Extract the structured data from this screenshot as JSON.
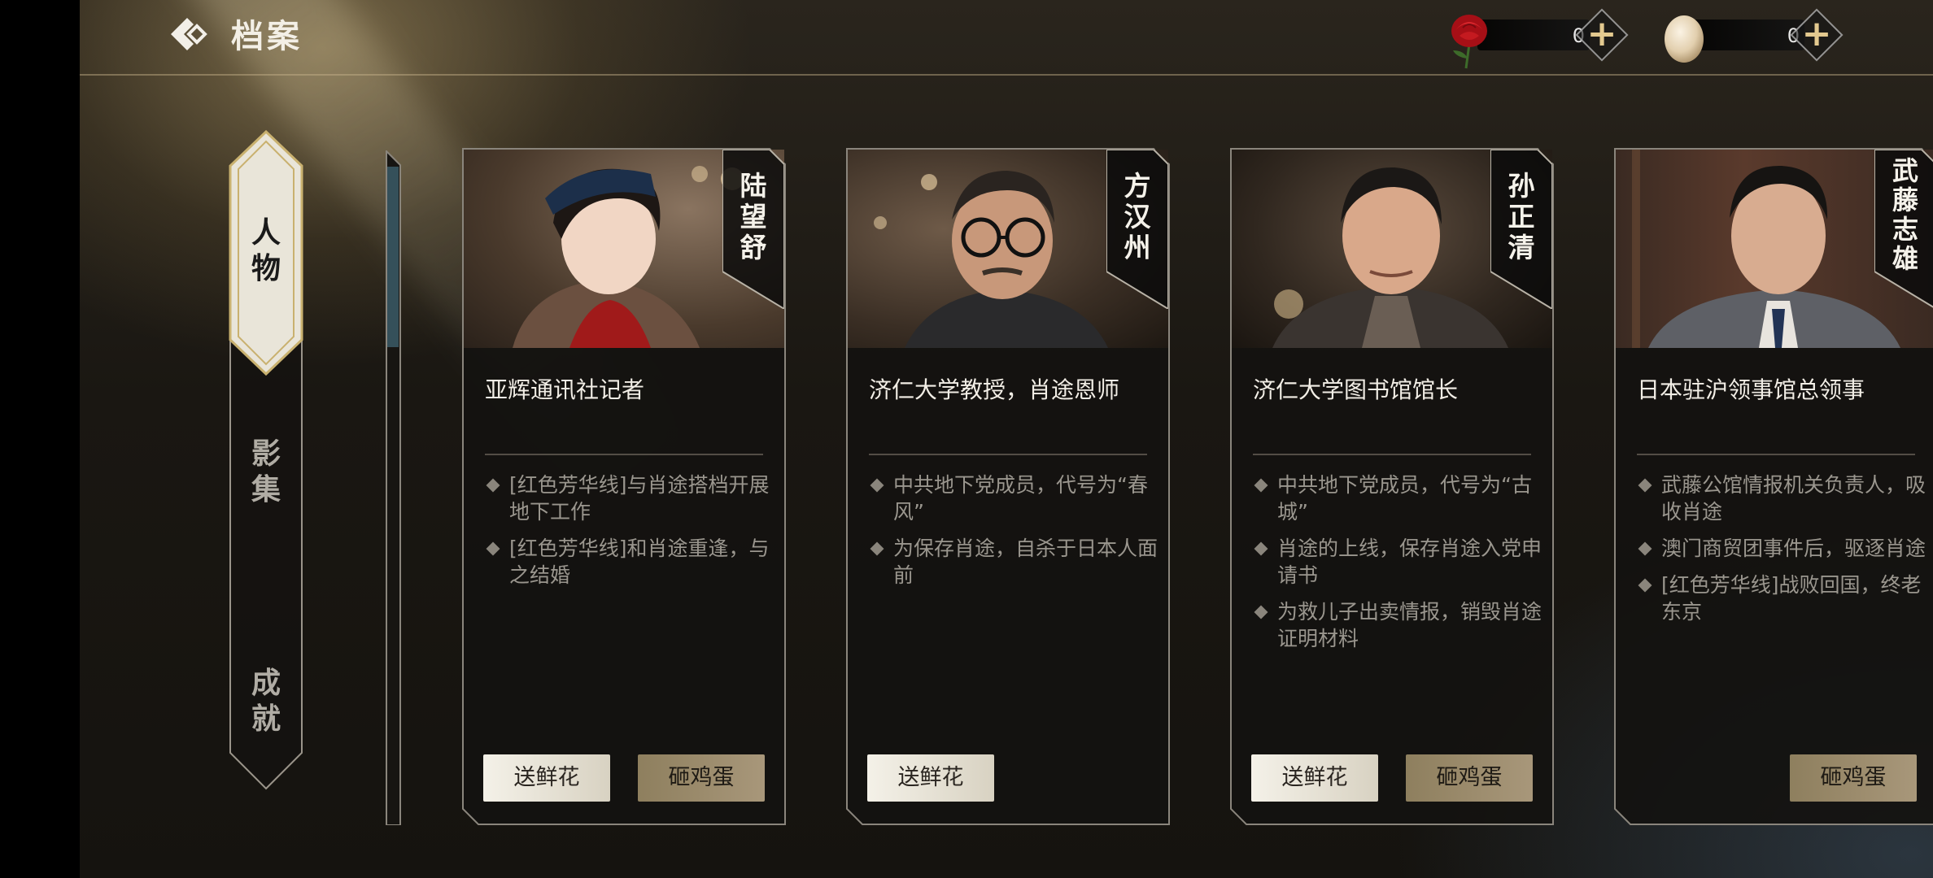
{
  "header": {
    "title": "档案"
  },
  "currencies": [
    {
      "name": "rose",
      "count": "0"
    },
    {
      "name": "egg",
      "count": "0"
    }
  ],
  "tabs": [
    {
      "label": "人物",
      "active": true
    },
    {
      "label": "影集",
      "active": false
    },
    {
      "label": "成就",
      "active": false
    }
  ],
  "cards": [
    {
      "name": "陆望舒",
      "role": "亚辉通讯社记者",
      "bullets": [
        "[红色芳华线]与肖途搭档开展地下工作",
        "[红色芳华线]和肖途重逢，与之结婚"
      ],
      "flower_label": "送鲜花",
      "egg_label": "砸鸡蛋"
    },
    {
      "name": "方汉州",
      "role": "济仁大学教授，肖途恩师",
      "bullets": [
        "中共地下党成员，代号为“春风”",
        "为保存肖途，自杀于日本人面前"
      ],
      "flower_label": "送鲜花",
      "egg_label": ""
    },
    {
      "name": "孙正清",
      "role": "济仁大学图书馆馆长",
      "bullets": [
        "中共地下党成员，代号为“古城”",
        "肖途的上线，保存肖途入党申请书",
        "为救儿子出卖情报，销毁肖途证明材料"
      ],
      "flower_label": "送鲜花",
      "egg_label": "砸鸡蛋"
    },
    {
      "name": "武藤志雄",
      "role": "日本驻沪领事馆总领事",
      "bullets": [
        "武藤公馆情报机关负责人，吸收肖途",
        "澳门商贸团事件后，驱逐肖途",
        "[红色芳华线]战败回国，终老东京"
      ],
      "flower_label": "",
      "egg_label": "砸鸡蛋"
    }
  ],
  "colors": {
    "accent_gold": "#e3c98f",
    "card_bg": "#141210",
    "flower_button": "#ece8dc",
    "egg_button": "#9c8c6c",
    "rose": "#c0141a"
  }
}
